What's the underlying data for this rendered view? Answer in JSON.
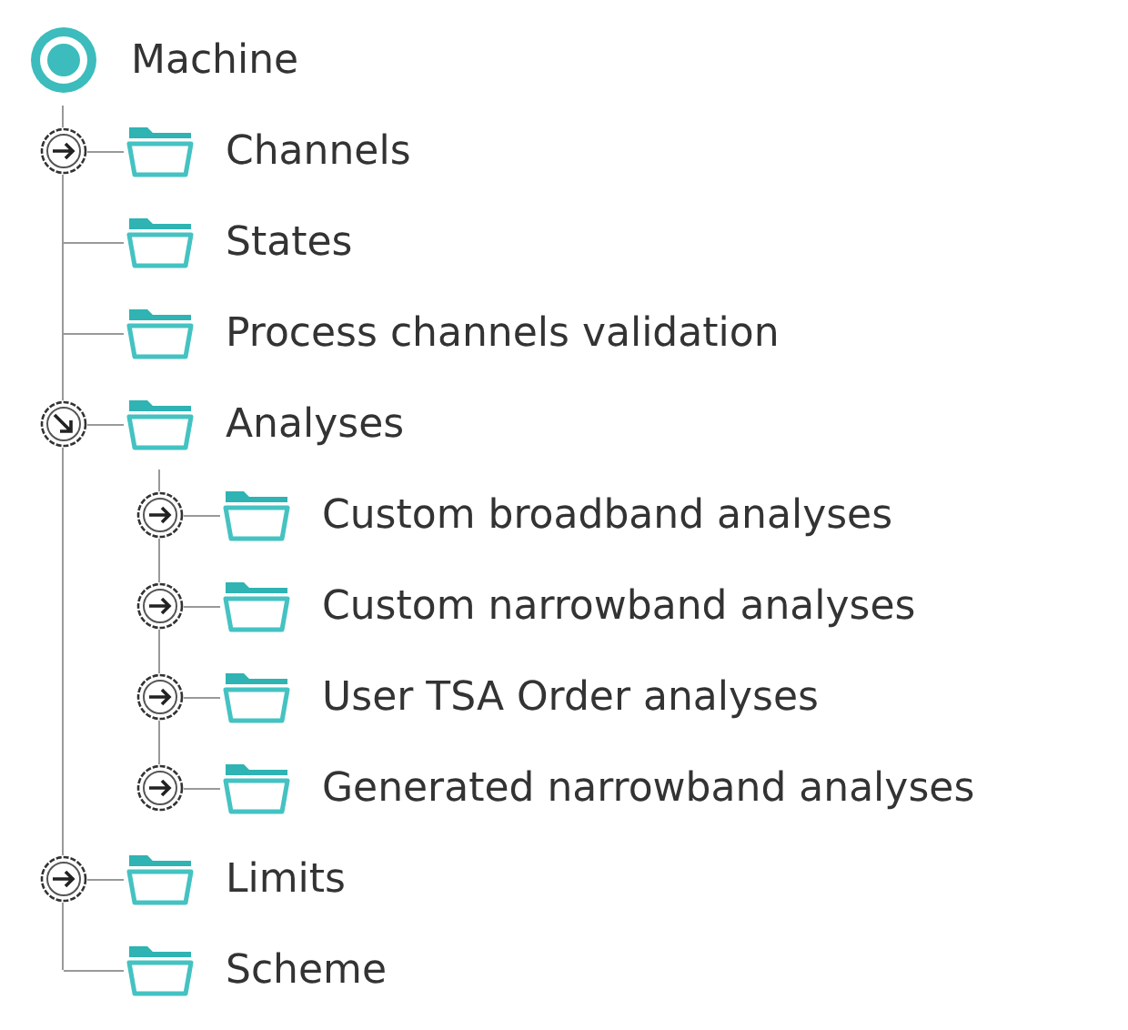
{
  "tree": {
    "label": "Machine",
    "children": [
      {
        "label": "Channels",
        "expanded": false
      },
      {
        "label": "States"
      },
      {
        "label": "Process channels validation"
      },
      {
        "label": "Analyses",
        "expanded": true,
        "children": [
          {
            "label": "Custom broadband analyses",
            "expanded": false
          },
          {
            "label": "Custom narrowband analyses",
            "expanded": false
          },
          {
            "label": "User TSA Order analyses",
            "expanded": false
          },
          {
            "label": "Generated narrowband analyses",
            "expanded": false
          }
        ]
      },
      {
        "label": "Limits",
        "expanded": false
      },
      {
        "label": "Scheme"
      }
    ]
  }
}
